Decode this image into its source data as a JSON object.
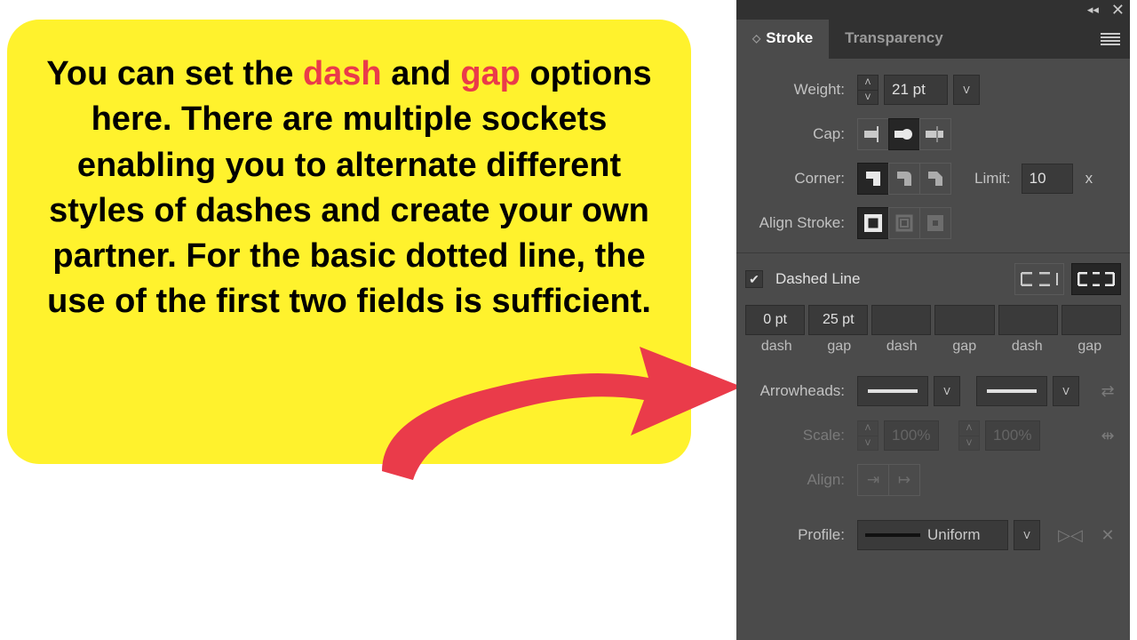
{
  "callout": {
    "pre": "You can set the ",
    "dash": "dash",
    "mid1": " and ",
    "gap": "gap",
    "rest": " options here. There are multiple sockets enabling you to alternate different styles of dashes and create your own partner. For the basic dotted line, the use of the first two fields is sufficient."
  },
  "tabs": {
    "stroke": "Stroke",
    "transparency": "Transparency"
  },
  "panel": {
    "weight_label": "Weight:",
    "weight_value": "21 pt",
    "cap_label": "Cap:",
    "corner_label": "Corner:",
    "limit_label": "Limit:",
    "limit_value": "10",
    "limit_suffix": "x",
    "align_stroke_label": "Align Stroke:",
    "dashed_line_label": "Dashed Line",
    "dash_values": [
      "0 pt",
      "25 pt",
      "",
      "",
      "",
      ""
    ],
    "dash_labels": [
      "dash",
      "gap",
      "dash",
      "gap",
      "dash",
      "gap"
    ],
    "arrowheads_label": "Arrowheads:",
    "scale_label": "Scale:",
    "scale_value1": "100%",
    "scale_value2": "100%",
    "align_label": "Align:",
    "profile_label": "Profile:",
    "profile_value": "Uniform"
  }
}
